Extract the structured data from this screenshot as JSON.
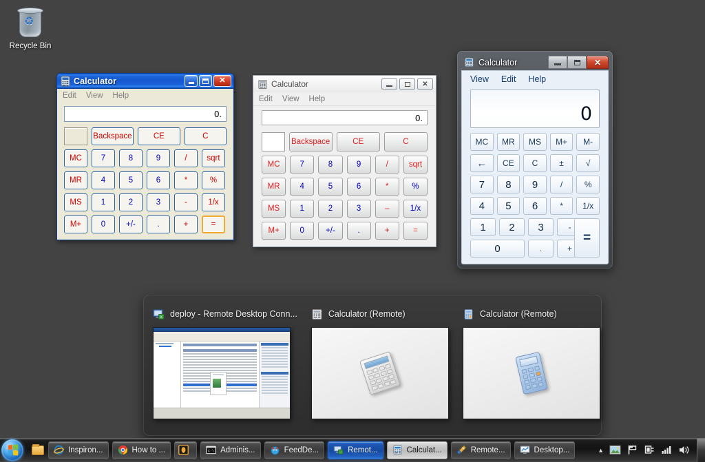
{
  "desktop": {
    "background_color": "#434343",
    "icons": [
      {
        "name": "recycle-bin",
        "label": "Recycle Bin"
      }
    ]
  },
  "windows": [
    {
      "id": "calc-xp-active",
      "style": "windows-xp-luna",
      "title": "Calculator",
      "active": true,
      "titlebar_color": "#1558cf",
      "window_buttons": [
        "minimize",
        "maximize",
        "close"
      ],
      "menu": [
        "Edit",
        "View",
        "Help"
      ],
      "display_value": "0.",
      "memory_indicator": "",
      "keys": [
        [
          "Backspace",
          "CE",
          "C"
        ],
        [
          "MC",
          "7",
          "8",
          "9",
          "/",
          "sqrt"
        ],
        [
          "MR",
          "4",
          "5",
          "6",
          "*",
          "%"
        ],
        [
          "MS",
          "1",
          "2",
          "3",
          "-",
          "1/x"
        ],
        [
          "M+",
          "0",
          "+/-",
          ".",
          "+",
          "="
        ]
      ],
      "focused_key": "="
    },
    {
      "id": "calc-basic-inactive",
      "style": "windows-basic",
      "title": "Calculator",
      "active": false,
      "window_buttons": [
        "minimize",
        "restore",
        "close"
      ],
      "menu": [
        "Edit",
        "View",
        "Help"
      ],
      "display_value": "0.",
      "memory_indicator": "",
      "keys": [
        [
          "Backspace",
          "CE",
          "C"
        ],
        [
          "MC",
          "7",
          "8",
          "9",
          "/",
          "sqrt"
        ],
        [
          "MR",
          "4",
          "5",
          "6",
          "*",
          "%"
        ],
        [
          "MS",
          "1",
          "2",
          "3",
          "–",
          "1/x"
        ],
        [
          "M+",
          "0",
          "+/-",
          ".",
          "+",
          "="
        ]
      ]
    },
    {
      "id": "calc-aero",
      "style": "windows-7-aero",
      "title": "Calculator",
      "active": false,
      "window_buttons": [
        "minimize",
        "maximize",
        "close"
      ],
      "menu": [
        "View",
        "Edit",
        "Help"
      ],
      "display_value": "0",
      "keys": [
        [
          "MC",
          "MR",
          "MS",
          "M+",
          "M-"
        ],
        [
          "←",
          "CE",
          "C",
          "±",
          "√"
        ],
        [
          "7",
          "8",
          "9",
          "/",
          "%"
        ],
        [
          "4",
          "5",
          "6",
          "*",
          "1/x"
        ],
        [
          "1",
          "2",
          "3",
          "-",
          "="
        ],
        [
          "0",
          ".",
          "+"
        ]
      ]
    }
  ],
  "switcher": {
    "name": "window-switcher-panel",
    "thumbnails": [
      {
        "title": "deploy - Remote Desktop Conn...",
        "icon": "remote-desktop-icon",
        "preview": "server-manager-mmc"
      },
      {
        "title": "Calculator (Remote)",
        "icon": "calculator-gray-icon",
        "preview": "calculator-gray"
      },
      {
        "title": "Calculator (Remote)",
        "icon": "calculator-blue-icon",
        "preview": "calculator-blue"
      }
    ]
  },
  "taskbar": {
    "start_button": "start-orb",
    "quick_launch": [
      {
        "name": "explorer-icon"
      }
    ],
    "buttons": [
      {
        "label": "Inspiron...",
        "icon": "internet-explorer-icon",
        "state": "normal"
      },
      {
        "label": "How to ...",
        "icon": "chrome-icon",
        "state": "normal"
      },
      {
        "label": "",
        "icon": "opera-icon",
        "state": "normal"
      },
      {
        "label": "Adminis...",
        "icon": "command-prompt-icon",
        "state": "normal"
      },
      {
        "label": "FeedDe...",
        "icon": "feeddemon-icon",
        "state": "normal"
      },
      {
        "label": "Remot...",
        "icon": "remote-desktop-icon",
        "state": "active"
      },
      {
        "label": "Calculat...",
        "icon": "calculator-icon",
        "state": "hover"
      },
      {
        "label": "Remote...",
        "icon": "remote-tool-icon",
        "state": "normal"
      },
      {
        "label": "Desktop...",
        "icon": "monitor-icon",
        "state": "normal"
      }
    ],
    "tray": [
      {
        "name": "show-hidden-icons-chevron"
      },
      {
        "name": "picture-tray-icon"
      },
      {
        "name": "flag-action-center-icon"
      },
      {
        "name": "network-plug-icon"
      },
      {
        "name": "signal-bars-icon"
      },
      {
        "name": "volume-speaker-icon"
      }
    ],
    "show_desktop": "show-desktop-button"
  }
}
